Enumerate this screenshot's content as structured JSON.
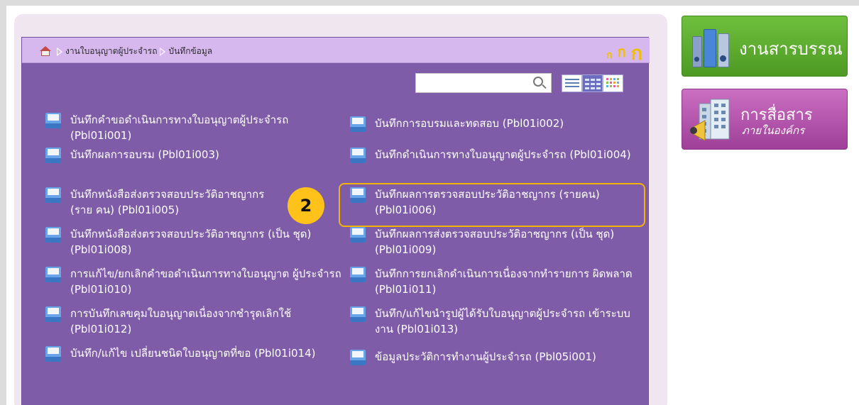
{
  "breadcrumb": {
    "items": [
      "งานใบอนุญาตผู้ประจำรถ",
      "บันทึกข้อมูล"
    ]
  },
  "font_size_controls": [
    "ก",
    "ก",
    "ก"
  ],
  "search": {
    "value": "",
    "placeholder": ""
  },
  "menu_items_left": [
    "บันทึกคำขอดำเนินการทางใบอนุญาตผู้ประจำรถ (Pbl01i001)",
    "บันทึกผลการอบรม (Pbl01i003)",
    "บันทึกหนังสือส่งตรวจสอบประวัติอาชญากร (ราย คน) (Pbl01i005)",
    "บันทึกหนังสือส่งตรวจสอบประวัติอาชญากร (เป็น ชุด) (Pbl01i008)",
    "การแก้ไข/ยกเลิกคำขอดำเนินการทางใบอนุญาต ผู้ประจำรถ (Pbl01i010)",
    "การบันทึกเลขคุมใบอนุญาตเนื่องจากชำรุดเลิกใช้ (Pbl01i012)",
    "บันทึก/แก้ไข เปลี่ยนชนิดใบอนุญาตที่ขอ (Pbl01i014)"
  ],
  "menu_items_right": [
    "บันทึกการอบรมและทดสอบ (Pbl01i002)",
    "บันทึกดำเนินการทางใบอนุญาตผู้ประจำรถ (Pbl01i004)",
    "บันทึกผลการตรวจสอบประวัติอาชญากร (รายคน) (Pbl01i006)",
    "บันทึกผลการส่งตรวจสอบประวัติอาชญากร (เป็น ชุด) (Pbl01i009)",
    "บันทึกการยกเลิกดำเนินการเนื่องจากทำรายการ ผิดพลาด (Pbl01i011)",
    "บันทึก/แก้ไขนำรูปผู้ได้รับใบอนุญาตผู้ประจำรถ เข้าระบบงาน (Pbl01i013)",
    "ข้อมูลประวัติการทำงานผู้ประจำรถ (Pbl05i001)"
  ],
  "step_marker": "2",
  "side_buttons": {
    "library": "งานสารบรรณ",
    "communication_title": "การสื่อสาร",
    "communication_subtitle": "ภายในองค์กร"
  },
  "colors": {
    "panel_purple": "#7f5ca8",
    "title_bar": "#d7b8ee",
    "highlight": "#f2b400",
    "library_green": "#5aa82c",
    "communication_magenta": "#b24fab"
  }
}
